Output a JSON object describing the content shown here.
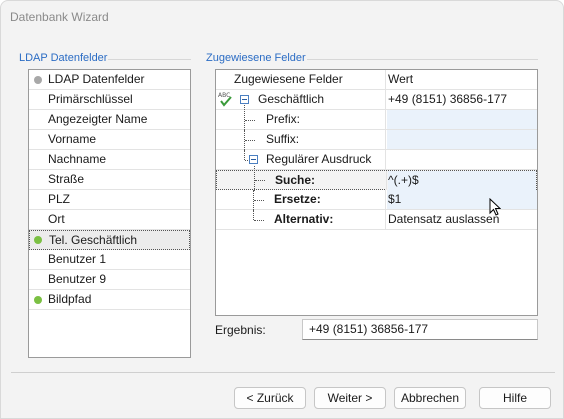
{
  "window": {
    "title": "Datenbank Wizard"
  },
  "left_group": {
    "label": "LDAP Datenfelder",
    "items": [
      {
        "label": "LDAP Datenfelder",
        "dot": "gray"
      },
      {
        "label": "Primärschlüssel",
        "dot": ""
      },
      {
        "label": "Angezeigter Name",
        "dot": ""
      },
      {
        "label": "Vorname",
        "dot": ""
      },
      {
        "label": "Nachname",
        "dot": ""
      },
      {
        "label": "Straße",
        "dot": ""
      },
      {
        "label": "PLZ",
        "dot": ""
      },
      {
        "label": "Ort",
        "dot": ""
      },
      {
        "label": "Tel. Geschäftlich",
        "dot": "green",
        "selected": true
      },
      {
        "label": "Benutzer 1",
        "dot": ""
      },
      {
        "label": "Benutzer 9",
        "dot": ""
      },
      {
        "label": "Bildpfad",
        "dot": "green"
      }
    ]
  },
  "right_group": {
    "label": "Zugewiesene Felder",
    "columns": {
      "field": "Zugewiesene Felder",
      "value": "Wert"
    },
    "rows": {
      "business": {
        "label": "Geschäftlich",
        "value": "+49 (8151) 36856-177"
      },
      "prefix": {
        "label": "Prefix:",
        "value": ""
      },
      "suffix": {
        "label": "Suffix:",
        "value": ""
      },
      "regex": {
        "label": "Regulärer Ausdruck",
        "value": ""
      },
      "search": {
        "label": "Suche:",
        "value": "^(.+)$"
      },
      "replace": {
        "label": "Ersetze:",
        "value": "$1"
      },
      "alternative": {
        "label": "Alternativ:",
        "value": "Datensatz auslassen"
      }
    },
    "result": {
      "label": "Ergebnis:",
      "value": "+49 (8151) 36856-177"
    }
  },
  "buttons": {
    "back": "< Zurück",
    "next": "Weiter >",
    "cancel": "Abbrechen",
    "help": "Hilfe"
  },
  "colors": {
    "accent": "#2b6cc4",
    "status_green": "#7bc043",
    "status_gray": "#a8a8a8",
    "value_cell": "#eaf2fb"
  }
}
